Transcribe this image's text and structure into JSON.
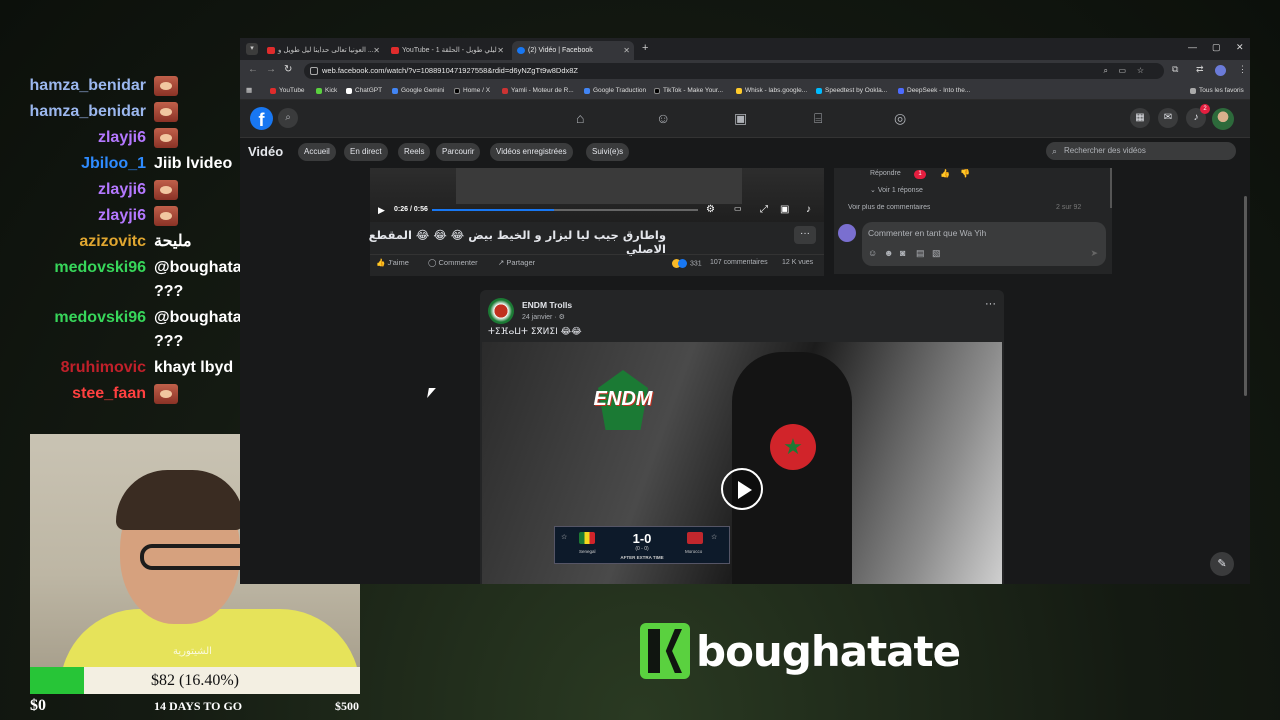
{
  "chat": [
    {
      "user": "hamza_benidar",
      "color": "#9bb7ee",
      "message": "",
      "emote": true
    },
    {
      "user": "hamza_benidar",
      "color": "#9bb7ee",
      "message": "",
      "emote": true
    },
    {
      "user": "zlayji6",
      "color": "#b478ff",
      "message": "",
      "emote": true
    },
    {
      "user": "Jbiloo_1",
      "color": "#2e8bff",
      "message": "Jiib lvideo",
      "emote": false
    },
    {
      "user": "zlayji6",
      "color": "#b478ff",
      "message": "",
      "emote": true
    },
    {
      "user": "zlayji6",
      "color": "#b478ff",
      "message": "",
      "emote": true
    },
    {
      "user": "azizovitc",
      "color": "#e0a630",
      "message": "مليحة",
      "emote": false
    },
    {
      "user": "medovski96",
      "color": "#37d65a",
      "message": "@boughatate baghi tferej ???",
      "emote": false
    },
    {
      "user": "medovski96",
      "color": "#37d65a",
      "message": "@boughatate baghi tferej ???",
      "emote": false
    },
    {
      "user": "8ruhimovic",
      "color": "#c0202a",
      "message": "khayt lbyd",
      "emote": false
    },
    {
      "user": "stee_faan",
      "color": "#ff4040",
      "message": "",
      "emote": true
    }
  ],
  "webcam": {
    "caption": "الشيتورية"
  },
  "goal": {
    "text": "$82 (16.40%)",
    "percent": 16.4,
    "min": "$0",
    "max": "$500",
    "deadline": "14 DAYS TO GO",
    "fill_color": "#27c537"
  },
  "brand": {
    "name": "boughatate"
  },
  "browser": {
    "tabs": [
      {
        "title": "العونيا تعالى حداينا ليل طويل و ...",
        "active": false,
        "icon": "youtube-icon"
      },
      {
        "title": "YouTube - ليلي طويل - الحلقة 1",
        "active": false,
        "icon": "youtube-icon"
      },
      {
        "title": "(2) Vidéo | Facebook",
        "active": true,
        "icon": "facebook-icon"
      }
    ],
    "url": "web.facebook.com/watch/?v=1088910471927558&rdid=d6yNZgTt9w8Ddx8Z",
    "bookmarks": [
      "YouTube",
      "Kick",
      "ChatGPT",
      "Google Gemini",
      "Home / X",
      "Yamli - Moteur de R...",
      "Google Traduction",
      "TikTok - Make Your...",
      "Whisk - labs.google...",
      "Speedtest by Ookla...",
      "DeepSeek - Into the..."
    ],
    "all_bookmarks": "Tous les favoris"
  },
  "facebook": {
    "notif_count": "2",
    "section_title": "Vidéo",
    "tabs": [
      "Accueil",
      "En direct",
      "Reels",
      "Parcourir",
      "Vidéos enregistrées",
      "Suivi(e)s"
    ],
    "search_placeholder": "Rechercher des vidéos",
    "player": {
      "time": "0:26 / 0:56",
      "progress": 0.46
    },
    "post1": {
      "text": "واطارق جيب ليا ليزار و الخيط بيض 😂 😂 😂 المقطع الاصلي",
      "like": "J'aime",
      "comment": "Commenter",
      "share": "Partager",
      "reactions": "331",
      "comments": "107 commentaires",
      "views": "12 K vues"
    },
    "comments_panel": {
      "reply": "Répondre",
      "heart_count": "1",
      "see_reply": "Voir 1 réponse",
      "see_more": "Voir plus de commentaires",
      "time": "2 sur 92",
      "placeholder": "Commenter en tant que Wa Yih"
    },
    "post2": {
      "author": "ENDM Trolls",
      "date": "24 janvier · ",
      "text": "ⵜⵉⴼⴰⵡⵜ ⵉⴳⵍⵉⵏ 😂😂",
      "logo_text": "ENDM",
      "score": {
        "value": "1-0",
        "sub": "(0 - 0)",
        "note": "AFTER EXTRA TIME",
        "home": "Senegal",
        "away": "Morocco"
      }
    }
  }
}
